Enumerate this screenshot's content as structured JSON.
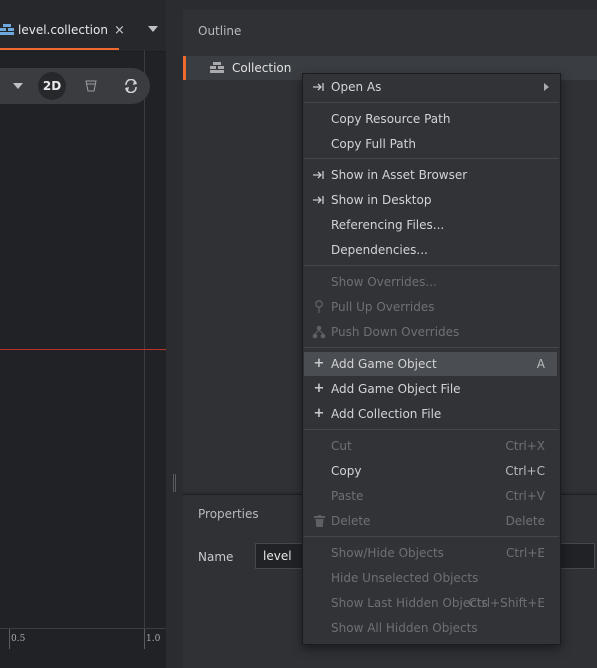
{
  "editor": {
    "tab": {
      "label": "level.collection",
      "close": "×"
    },
    "toolbar": {
      "mode_2d": "2D"
    },
    "ruler": {
      "labels": [
        "0.5",
        "1.0"
      ]
    }
  },
  "outline": {
    "title": "Outline",
    "root_item": "Collection"
  },
  "properties": {
    "title": "Properties",
    "name_label": "Name",
    "name_value": "level"
  },
  "context_menu": {
    "items": [
      {
        "label": "Open As",
        "shortcut": "",
        "disabled": false,
        "icon": "open-as-icon",
        "submenu": true
      },
      {
        "label": "Copy Resource Path",
        "shortcut": "",
        "disabled": false
      },
      {
        "label": "Copy Full Path",
        "shortcut": "",
        "disabled": false
      },
      {
        "label": "Show in Asset Browser",
        "shortcut": "",
        "disabled": false,
        "icon": "show-in-icon"
      },
      {
        "label": "Show in Desktop",
        "shortcut": "",
        "disabled": false,
        "icon": "show-in-icon"
      },
      {
        "label": "Referencing Files...",
        "shortcut": "",
        "disabled": false
      },
      {
        "label": "Dependencies...",
        "shortcut": "",
        "disabled": false
      },
      {
        "label": "Show Overrides...",
        "shortcut": "",
        "disabled": true
      },
      {
        "label": "Pull Up Overrides",
        "shortcut": "",
        "disabled": true,
        "icon": "pull-up-icon"
      },
      {
        "label": "Push Down Overrides",
        "shortcut": "",
        "disabled": true,
        "icon": "push-down-icon"
      },
      {
        "label": "Add Game Object",
        "shortcut": "A",
        "disabled": false,
        "icon": "plus-icon",
        "highlighted": true
      },
      {
        "label": "Add Game Object File",
        "shortcut": "",
        "disabled": false,
        "icon": "plus-icon"
      },
      {
        "label": "Add Collection File",
        "shortcut": "",
        "disabled": false,
        "icon": "plus-icon"
      },
      {
        "label": "Cut",
        "shortcut": "Ctrl+X",
        "disabled": true
      },
      {
        "label": "Copy",
        "shortcut": "Ctrl+C",
        "disabled": false
      },
      {
        "label": "Paste",
        "shortcut": "Ctrl+V",
        "disabled": true
      },
      {
        "label": "Delete",
        "shortcut": "Delete",
        "disabled": true,
        "icon": "trash-icon"
      },
      {
        "label": "Show/Hide Objects",
        "shortcut": "Ctrl+E",
        "disabled": true
      },
      {
        "label": "Hide Unselected Objects",
        "shortcut": "",
        "disabled": true
      },
      {
        "label": "Show Last Hidden Objects",
        "shortcut": "Ctrl+Shift+E",
        "disabled": true
      },
      {
        "label": "Show All Hidden Objects",
        "shortcut": "",
        "disabled": true
      }
    ]
  },
  "colors": {
    "accent": "#ee6a2f",
    "axis_red": "#b8342c",
    "plus_blue": "#8fc0ec"
  }
}
